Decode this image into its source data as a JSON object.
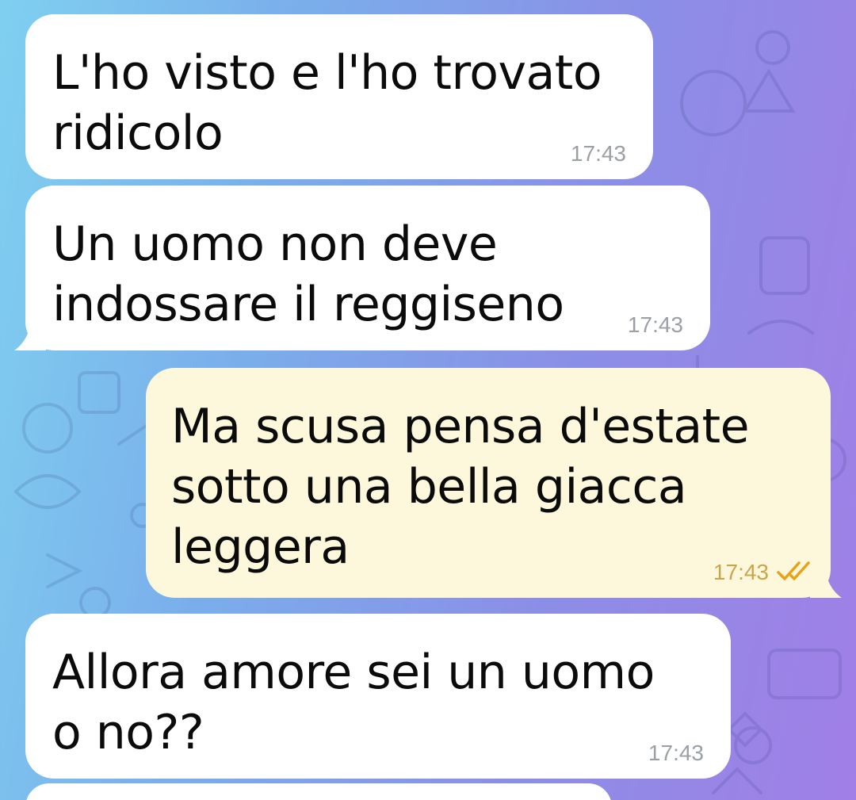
{
  "chat": {
    "messages": [
      {
        "direction": "incoming",
        "text": "L'ho visto e l'ho trovato\nridicolo",
        "time": "17:43"
      },
      {
        "direction": "incoming",
        "text": "Un uomo non deve\nindossare il reggiseno",
        "time": "17:43"
      },
      {
        "direction": "outgoing",
        "text": "Ma scusa pensa d'estate\nsotto una bella giacca\nleggera",
        "time": "17:43",
        "status": "read"
      },
      {
        "direction": "incoming",
        "text": "Allora amore sei un uomo\no no??",
        "time": "17:43"
      }
    ]
  },
  "colors": {
    "incoming_bubble": "#ffffff",
    "outgoing_bubble": "#fdf8dc",
    "timestamp": "#9aa0a6",
    "outgoing_timestamp": "#c9a64a",
    "read_ticks": "#e8a21a"
  },
  "icons": {
    "read_status": "double-check-icon",
    "background": "doodle-pattern"
  }
}
